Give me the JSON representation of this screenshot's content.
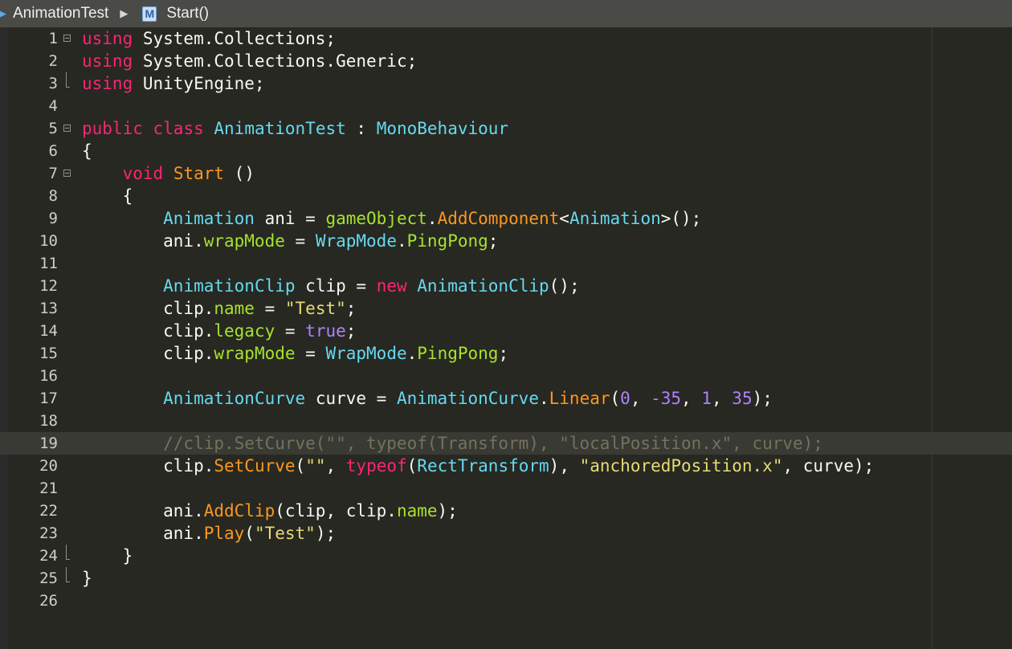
{
  "breadcrumb": {
    "file": "AnimationTest",
    "member_badge": "M",
    "member": "Start()"
  },
  "editor": {
    "current_line": 19,
    "lines": [
      {
        "num": "1",
        "fold": "open",
        "tokens": [
          {
            "t": "using",
            "c": "keyword"
          },
          {
            "t": " System.Collections;",
            "c": "plain"
          }
        ]
      },
      {
        "num": "2",
        "fold": "",
        "tokens": [
          {
            "t": "using",
            "c": "keyword"
          },
          {
            "t": " System.Collections.Generic;",
            "c": "plain"
          }
        ]
      },
      {
        "num": "3",
        "fold": "end",
        "tokens": [
          {
            "t": "using",
            "c": "keyword"
          },
          {
            "t": " UnityEngine;",
            "c": "plain"
          }
        ]
      },
      {
        "num": "4",
        "fold": "",
        "tokens": []
      },
      {
        "num": "5",
        "fold": "open",
        "tokens": [
          {
            "t": "public",
            "c": "keyword"
          },
          {
            "t": " ",
            "c": "plain"
          },
          {
            "t": "class",
            "c": "keyword"
          },
          {
            "t": " ",
            "c": "plain"
          },
          {
            "t": "AnimationTest",
            "c": "type"
          },
          {
            "t": " : ",
            "c": "plain"
          },
          {
            "t": "MonoBehaviour",
            "c": "type"
          }
        ]
      },
      {
        "num": "6",
        "fold": "",
        "tokens": [
          {
            "t": "{",
            "c": "plain"
          }
        ]
      },
      {
        "num": "7",
        "fold": "open",
        "tokens": [
          {
            "t": "    ",
            "c": "plain"
          },
          {
            "t": "void",
            "c": "keyword"
          },
          {
            "t": " ",
            "c": "plain"
          },
          {
            "t": "Start",
            "c": "method"
          },
          {
            "t": " ()",
            "c": "plain"
          }
        ]
      },
      {
        "num": "8",
        "fold": "",
        "tokens": [
          {
            "t": "    {",
            "c": "plain"
          }
        ]
      },
      {
        "num": "9",
        "fold": "",
        "tokens": [
          {
            "t": "        ",
            "c": "plain"
          },
          {
            "t": "Animation",
            "c": "type"
          },
          {
            "t": " ani = ",
            "c": "plain"
          },
          {
            "t": "gameObject",
            "c": "member"
          },
          {
            "t": ".",
            "c": "plain"
          },
          {
            "t": "AddComponent",
            "c": "method"
          },
          {
            "t": "<",
            "c": "plain"
          },
          {
            "t": "Animation",
            "c": "type"
          },
          {
            "t": ">();",
            "c": "plain"
          }
        ]
      },
      {
        "num": "10",
        "fold": "",
        "tokens": [
          {
            "t": "        ani.",
            "c": "plain"
          },
          {
            "t": "wrapMode",
            "c": "member"
          },
          {
            "t": " = ",
            "c": "plain"
          },
          {
            "t": "WrapMode",
            "c": "type"
          },
          {
            "t": ".",
            "c": "plain"
          },
          {
            "t": "PingPong",
            "c": "member"
          },
          {
            "t": ";",
            "c": "plain"
          }
        ]
      },
      {
        "num": "11",
        "fold": "",
        "tokens": []
      },
      {
        "num": "12",
        "fold": "",
        "tokens": [
          {
            "t": "        ",
            "c": "plain"
          },
          {
            "t": "AnimationClip",
            "c": "type"
          },
          {
            "t": " clip = ",
            "c": "plain"
          },
          {
            "t": "new",
            "c": "keyword"
          },
          {
            "t": " ",
            "c": "plain"
          },
          {
            "t": "AnimationClip",
            "c": "type"
          },
          {
            "t": "();",
            "c": "plain"
          }
        ]
      },
      {
        "num": "13",
        "fold": "",
        "tokens": [
          {
            "t": "        clip.",
            "c": "plain"
          },
          {
            "t": "name",
            "c": "member"
          },
          {
            "t": " = ",
            "c": "plain"
          },
          {
            "t": "\"Test\"",
            "c": "string"
          },
          {
            "t": ";",
            "c": "plain"
          }
        ]
      },
      {
        "num": "14",
        "fold": "",
        "tokens": [
          {
            "t": "        clip.",
            "c": "plain"
          },
          {
            "t": "legacy",
            "c": "member"
          },
          {
            "t": " = ",
            "c": "plain"
          },
          {
            "t": "true",
            "c": "number"
          },
          {
            "t": ";",
            "c": "plain"
          }
        ]
      },
      {
        "num": "15",
        "fold": "",
        "tokens": [
          {
            "t": "        clip.",
            "c": "plain"
          },
          {
            "t": "wrapMode",
            "c": "member"
          },
          {
            "t": " = ",
            "c": "plain"
          },
          {
            "t": "WrapMode",
            "c": "type"
          },
          {
            "t": ".",
            "c": "plain"
          },
          {
            "t": "PingPong",
            "c": "member"
          },
          {
            "t": ";",
            "c": "plain"
          }
        ]
      },
      {
        "num": "16",
        "fold": "",
        "tokens": []
      },
      {
        "num": "17",
        "fold": "",
        "tokens": [
          {
            "t": "        ",
            "c": "plain"
          },
          {
            "t": "AnimationCurve",
            "c": "type"
          },
          {
            "t": " curve = ",
            "c": "plain"
          },
          {
            "t": "AnimationCurve",
            "c": "type"
          },
          {
            "t": ".",
            "c": "plain"
          },
          {
            "t": "Linear",
            "c": "method"
          },
          {
            "t": "(",
            "c": "plain"
          },
          {
            "t": "0",
            "c": "number"
          },
          {
            "t": ", ",
            "c": "plain"
          },
          {
            "t": "-35",
            "c": "number"
          },
          {
            "t": ", ",
            "c": "plain"
          },
          {
            "t": "1",
            "c": "number"
          },
          {
            "t": ", ",
            "c": "plain"
          },
          {
            "t": "35",
            "c": "number"
          },
          {
            "t": ");",
            "c": "plain"
          }
        ]
      },
      {
        "num": "18",
        "fold": "",
        "tokens": []
      },
      {
        "num": "19",
        "fold": "",
        "tokens": [
          {
            "t": "        //clip.SetCurve(\"\", typeof(Transform), \"localPosition.x\", curve);",
            "c": "comment"
          }
        ]
      },
      {
        "num": "20",
        "fold": "",
        "tokens": [
          {
            "t": "        clip.",
            "c": "plain"
          },
          {
            "t": "SetCurve",
            "c": "method"
          },
          {
            "t": "(",
            "c": "plain"
          },
          {
            "t": "\"\"",
            "c": "string"
          },
          {
            "t": ", ",
            "c": "plain"
          },
          {
            "t": "typeof",
            "c": "keyword"
          },
          {
            "t": "(",
            "c": "plain"
          },
          {
            "t": "RectTransform",
            "c": "type"
          },
          {
            "t": "), ",
            "c": "plain"
          },
          {
            "t": "\"anchoredPosition.x\"",
            "c": "string"
          },
          {
            "t": ", curve);",
            "c": "plain"
          }
        ]
      },
      {
        "num": "21",
        "fold": "",
        "tokens": []
      },
      {
        "num": "22",
        "fold": "",
        "tokens": [
          {
            "t": "        ani.",
            "c": "plain"
          },
          {
            "t": "AddClip",
            "c": "method"
          },
          {
            "t": "(clip, clip.",
            "c": "plain"
          },
          {
            "t": "name",
            "c": "member"
          },
          {
            "t": ");",
            "c": "plain"
          }
        ]
      },
      {
        "num": "23",
        "fold": "",
        "tokens": [
          {
            "t": "        ani.",
            "c": "plain"
          },
          {
            "t": "Play",
            "c": "method"
          },
          {
            "t": "(",
            "c": "plain"
          },
          {
            "t": "\"Test\"",
            "c": "string"
          },
          {
            "t": ");",
            "c": "plain"
          }
        ]
      },
      {
        "num": "24",
        "fold": "end",
        "tokens": [
          {
            "t": "    }",
            "c": "plain"
          }
        ]
      },
      {
        "num": "25",
        "fold": "end",
        "tokens": [
          {
            "t": "}",
            "c": "plain"
          }
        ]
      },
      {
        "num": "26",
        "fold": "",
        "tokens": []
      }
    ]
  }
}
